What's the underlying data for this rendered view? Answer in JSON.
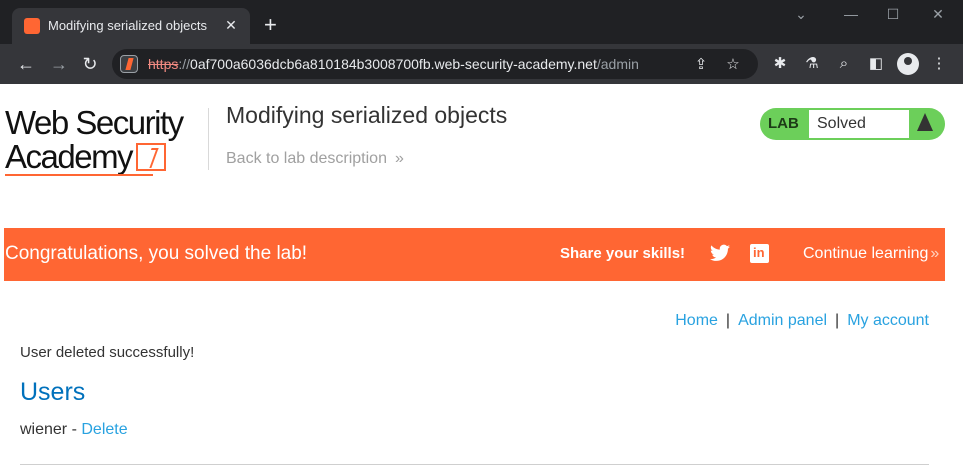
{
  "browser": {
    "tab_title": "Modifying serialized objects",
    "url_scheme": "https",
    "url_sep": "://",
    "url_host": "0af700a6036dcb6a810184b3008700fb.web-security-academy.net",
    "url_path": "/admin"
  },
  "header": {
    "logo_line1": "Web Security",
    "logo_line2": "Academy",
    "lab_title": "Modifying serialized objects",
    "back_link": "Back to lab description",
    "status_label": "LAB",
    "status_value": "Solved"
  },
  "banner": {
    "message": "Congratulations, you solved the lab!",
    "share_label": "Share your skills!",
    "continue_label": "Continue learning"
  },
  "nav": {
    "home": "Home",
    "admin_panel": "Admin panel",
    "my_account": "My account",
    "separator": "|"
  },
  "content": {
    "message": "User deleted successfully!",
    "users_heading": "Users",
    "users": [
      {
        "name": "wiener",
        "separator": " - ",
        "action": "Delete"
      }
    ]
  },
  "colors": {
    "accent": "#ff6633",
    "solved": "#6ccf5a",
    "link": "#29a2e0",
    "heading": "#0071bc"
  }
}
